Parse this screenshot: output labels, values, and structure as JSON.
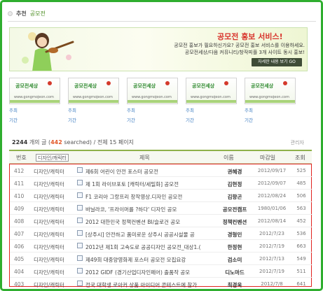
{
  "header": {
    "title": "추천",
    "subtitle": "공모전"
  },
  "banner": {
    "title": "공모전 홍보 서비스!",
    "line1": "공모전 홍보가 필요하신가요? 공모전 홍보 서비스를 이용하세요.",
    "line2": "공모전세상/다음 커뮤니티/창작피플 3개 사이트 동시 홍보!",
    "button": "자세한 내용 보기 GO"
  },
  "cards": [
    {
      "logo": "공모전세상",
      "url": "www.gongmojeon.com",
      "host_label": "주최",
      "period_label": "기간"
    },
    {
      "logo": "공모전세상",
      "url": "www.gongmojeon.com",
      "host_label": "주최",
      "period_label": "기간"
    },
    {
      "logo": "공모전세상",
      "url": "www.gongmojeon.com",
      "host_label": "주최",
      "period_label": "기간"
    },
    {
      "logo": "공모전세상",
      "url": "www.gongmojeon.com",
      "host_label": "주최",
      "period_label": "기간"
    },
    {
      "logo": "공모전세상",
      "url": "www.gongmojeon.com",
      "host_label": "주최",
      "period_label": "기간"
    }
  ],
  "stats": {
    "total": "2244",
    "total_suffix": "개의 글 (",
    "searched": "442",
    "searched_suffix": "searched)",
    "pages": "/ 전체 15 페이지",
    "admin": "관리자"
  },
  "table": {
    "headers": {
      "no": "번호",
      "category": "디자인/캐릭터",
      "title": "제목",
      "name": "이름",
      "date": "마감일",
      "views": "조회"
    },
    "rows": [
      {
        "no": "412",
        "category": "디자인/캐릭터",
        "title": "제6회 어린이 안전 포스터 공모전",
        "name": "권혜경",
        "date": "2012/09/17",
        "views": "525"
      },
      {
        "no": "411",
        "category": "디자인/캐릭터",
        "title": "제 1회 라이브포토 [캐릭터/세밀화] 공모전",
        "name": "김현정",
        "date": "2012/09/07",
        "views": "485"
      },
      {
        "no": "410",
        "category": "디자인/캐릭터",
        "title": "F1 코리아 그랑프리 창작영상.디자인 공모전",
        "name": "김향곤",
        "date": "2012/08/24",
        "views": "506"
      },
      {
        "no": "409",
        "category": "디자인/캐릭터",
        "title": "바닐라코, '프라이머를 ?하다' 디자인 공모",
        "name": "공모전캠프",
        "date": "1980/01/06",
        "views": "563"
      },
      {
        "no": "408",
        "category": "디자인/캐릭터",
        "title": "2012 대한민국 정책컨벤션 BI/슬로건 공모",
        "name": "정책컨벤션",
        "date": "2012/08/14",
        "views": "452"
      },
      {
        "no": "407",
        "category": "디자인/캐릭터",
        "title": "[상주시] 안전하고 품미로운 상주시 공공시설물 공",
        "name": "경형민",
        "date": "2012/7/23",
        "views": "536"
      },
      {
        "no": "406",
        "category": "디자인/캐릭터",
        "title": "2012년 제1회 고속도로 공공디자인 공모전_대상1.(",
        "name": "한정현",
        "date": "2012/7/19",
        "views": "663"
      },
      {
        "no": "405",
        "category": "디자인/캐릭터",
        "title": "제49회 대중양영화제 포스터 공모전 모집요강",
        "name": "검소미",
        "date": "2012/7/13",
        "views": "549"
      },
      {
        "no": "404",
        "category": "디자인/캐릭터",
        "title": "2012 GIDF (경기산업디자인페어) 출품작 공모",
        "name": "디노마드",
        "date": "2012/7/19",
        "views": "511"
      },
      {
        "no": "403",
        "category": "디자인/캐릭터",
        "title": "전국 대학생 로아커 상품 아이디어 콘테스트에 참가",
        "name": "최경욱",
        "date": "2012/7/8",
        "views": "641"
      }
    ]
  },
  "colors": {
    "frame": "#2fae2f",
    "highlight": "#e2592a",
    "selection_box": "#e0241f",
    "banner_title": "#d8342b"
  }
}
